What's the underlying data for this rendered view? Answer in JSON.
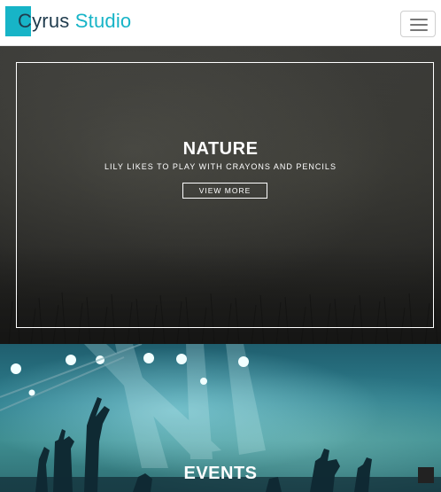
{
  "brand": {
    "name_prefix": "C",
    "name_middle": "yrus",
    "name_suffix": "Studio",
    "accent_color": "#17b4c7"
  },
  "header": {
    "menu_icon": "hamburger-icon"
  },
  "nature": {
    "title": "NATURE",
    "subtitle": "LILY LIKES TO PLAY WITH CRAYONS AND PENCILS",
    "button_label": "VIEW MORE"
  },
  "events": {
    "title": "EVENTS"
  },
  "scroll_top": {
    "icon": "back-to-top-icon"
  }
}
